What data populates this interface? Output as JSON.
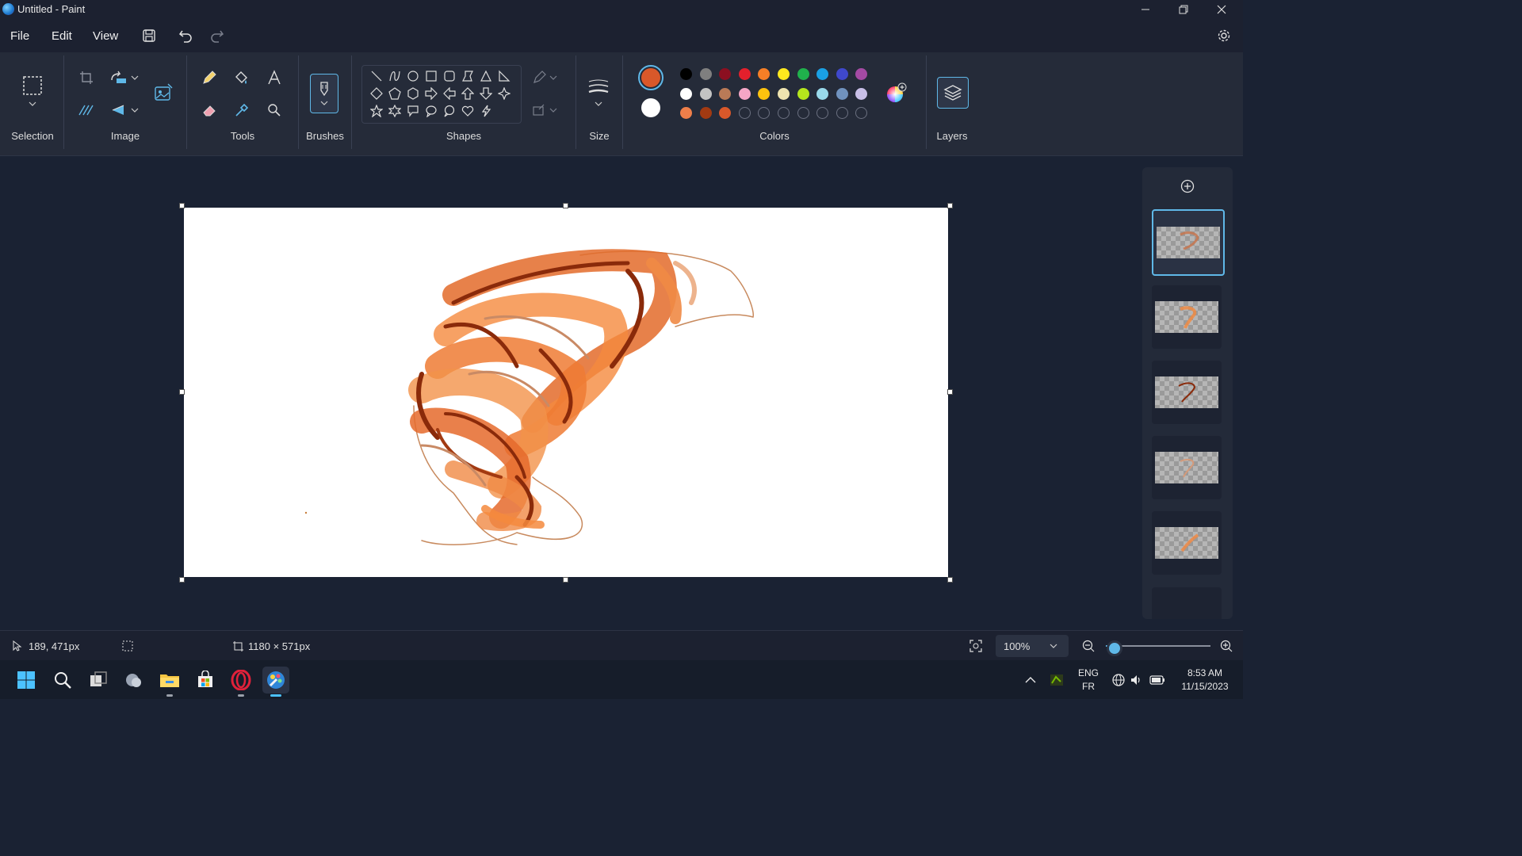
{
  "window": {
    "title": "Untitled - Paint"
  },
  "menu": {
    "file": "File",
    "edit": "Edit",
    "view": "View"
  },
  "ribbon": {
    "groups": {
      "selection": "Selection",
      "image": "Image",
      "tools": "Tools",
      "brushes": "Brushes",
      "shapes": "Shapes",
      "size": "Size",
      "colors": "Colors",
      "layers": "Layers"
    },
    "primary_color": "#d9582a",
    "secondary_color": "#ffffff",
    "palette": [
      [
        "#000000",
        "#7f7f7f",
        "#8b0f20",
        "#e3202c",
        "#f67f26",
        "#fde81e",
        "#20b14c",
        "#1aa0e4",
        "#3f48cc",
        "#a44aa3"
      ],
      [
        "#ffffff",
        "#c3c3c3",
        "#b97a57",
        "#f5a6c6",
        "#fdc20e",
        "#efe4b0",
        "#b5e61d",
        "#99d9ea",
        "#7092be",
        "#c8bfe7"
      ],
      [
        "#ef7f4a",
        "#a23a12",
        "#d9582a",
        "",
        "",
        "",
        "",
        "",
        "",
        ""
      ]
    ]
  },
  "status": {
    "cursor_position": "189, 471px",
    "canvas_size": "1180 × 571px",
    "zoom": "100%",
    "zoom_level": 0.08
  },
  "taskbar": {
    "language_top": "ENG",
    "language_bottom": "FR",
    "time": "8:53 AM",
    "date": "11/15/2023"
  }
}
